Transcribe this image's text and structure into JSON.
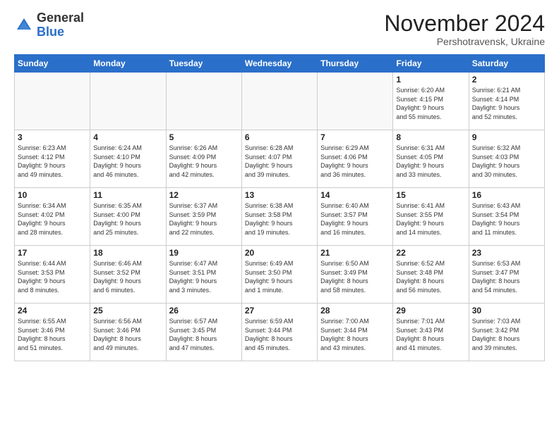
{
  "header": {
    "logo_general": "General",
    "logo_blue": "Blue",
    "month_title": "November 2024",
    "subtitle": "Pershotravensk, Ukraine"
  },
  "weekdays": [
    "Sunday",
    "Monday",
    "Tuesday",
    "Wednesday",
    "Thursday",
    "Friday",
    "Saturday"
  ],
  "weeks": [
    [
      {
        "day": "",
        "info": ""
      },
      {
        "day": "",
        "info": ""
      },
      {
        "day": "",
        "info": ""
      },
      {
        "day": "",
        "info": ""
      },
      {
        "day": "",
        "info": ""
      },
      {
        "day": "1",
        "info": "Sunrise: 6:20 AM\nSunset: 4:15 PM\nDaylight: 9 hours\nand 55 minutes."
      },
      {
        "day": "2",
        "info": "Sunrise: 6:21 AM\nSunset: 4:14 PM\nDaylight: 9 hours\nand 52 minutes."
      }
    ],
    [
      {
        "day": "3",
        "info": "Sunrise: 6:23 AM\nSunset: 4:12 PM\nDaylight: 9 hours\nand 49 minutes."
      },
      {
        "day": "4",
        "info": "Sunrise: 6:24 AM\nSunset: 4:10 PM\nDaylight: 9 hours\nand 46 minutes."
      },
      {
        "day": "5",
        "info": "Sunrise: 6:26 AM\nSunset: 4:09 PM\nDaylight: 9 hours\nand 42 minutes."
      },
      {
        "day": "6",
        "info": "Sunrise: 6:28 AM\nSunset: 4:07 PM\nDaylight: 9 hours\nand 39 minutes."
      },
      {
        "day": "7",
        "info": "Sunrise: 6:29 AM\nSunset: 4:06 PM\nDaylight: 9 hours\nand 36 minutes."
      },
      {
        "day": "8",
        "info": "Sunrise: 6:31 AM\nSunset: 4:05 PM\nDaylight: 9 hours\nand 33 minutes."
      },
      {
        "day": "9",
        "info": "Sunrise: 6:32 AM\nSunset: 4:03 PM\nDaylight: 9 hours\nand 30 minutes."
      }
    ],
    [
      {
        "day": "10",
        "info": "Sunrise: 6:34 AM\nSunset: 4:02 PM\nDaylight: 9 hours\nand 28 minutes."
      },
      {
        "day": "11",
        "info": "Sunrise: 6:35 AM\nSunset: 4:00 PM\nDaylight: 9 hours\nand 25 minutes."
      },
      {
        "day": "12",
        "info": "Sunrise: 6:37 AM\nSunset: 3:59 PM\nDaylight: 9 hours\nand 22 minutes."
      },
      {
        "day": "13",
        "info": "Sunrise: 6:38 AM\nSunset: 3:58 PM\nDaylight: 9 hours\nand 19 minutes."
      },
      {
        "day": "14",
        "info": "Sunrise: 6:40 AM\nSunset: 3:57 PM\nDaylight: 9 hours\nand 16 minutes."
      },
      {
        "day": "15",
        "info": "Sunrise: 6:41 AM\nSunset: 3:55 PM\nDaylight: 9 hours\nand 14 minutes."
      },
      {
        "day": "16",
        "info": "Sunrise: 6:43 AM\nSunset: 3:54 PM\nDaylight: 9 hours\nand 11 minutes."
      }
    ],
    [
      {
        "day": "17",
        "info": "Sunrise: 6:44 AM\nSunset: 3:53 PM\nDaylight: 9 hours\nand 8 minutes."
      },
      {
        "day": "18",
        "info": "Sunrise: 6:46 AM\nSunset: 3:52 PM\nDaylight: 9 hours\nand 6 minutes."
      },
      {
        "day": "19",
        "info": "Sunrise: 6:47 AM\nSunset: 3:51 PM\nDaylight: 9 hours\nand 3 minutes."
      },
      {
        "day": "20",
        "info": "Sunrise: 6:49 AM\nSunset: 3:50 PM\nDaylight: 9 hours\nand 1 minute."
      },
      {
        "day": "21",
        "info": "Sunrise: 6:50 AM\nSunset: 3:49 PM\nDaylight: 8 hours\nand 58 minutes."
      },
      {
        "day": "22",
        "info": "Sunrise: 6:52 AM\nSunset: 3:48 PM\nDaylight: 8 hours\nand 56 minutes."
      },
      {
        "day": "23",
        "info": "Sunrise: 6:53 AM\nSunset: 3:47 PM\nDaylight: 8 hours\nand 54 minutes."
      }
    ],
    [
      {
        "day": "24",
        "info": "Sunrise: 6:55 AM\nSunset: 3:46 PM\nDaylight: 8 hours\nand 51 minutes."
      },
      {
        "day": "25",
        "info": "Sunrise: 6:56 AM\nSunset: 3:46 PM\nDaylight: 8 hours\nand 49 minutes."
      },
      {
        "day": "26",
        "info": "Sunrise: 6:57 AM\nSunset: 3:45 PM\nDaylight: 8 hours\nand 47 minutes."
      },
      {
        "day": "27",
        "info": "Sunrise: 6:59 AM\nSunset: 3:44 PM\nDaylight: 8 hours\nand 45 minutes."
      },
      {
        "day": "28",
        "info": "Sunrise: 7:00 AM\nSunset: 3:44 PM\nDaylight: 8 hours\nand 43 minutes."
      },
      {
        "day": "29",
        "info": "Sunrise: 7:01 AM\nSunset: 3:43 PM\nDaylight: 8 hours\nand 41 minutes."
      },
      {
        "day": "30",
        "info": "Sunrise: 7:03 AM\nSunset: 3:42 PM\nDaylight: 8 hours\nand 39 minutes."
      }
    ]
  ]
}
